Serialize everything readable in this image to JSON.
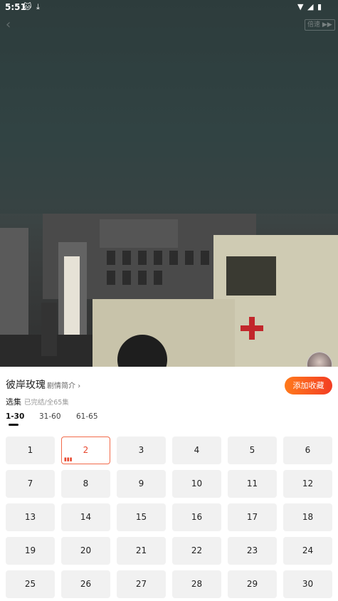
{
  "status_bar": {
    "time": "5:51"
  },
  "player": {
    "speed_label": "倍速"
  },
  "drama": {
    "title": "彼岸玫瑰",
    "synopsis_label": "剧情简介",
    "favorite_label": "添加收藏"
  },
  "episodes": {
    "section_label": "选集",
    "status_text": "已完结/全65集",
    "ranges": [
      "1-30",
      "31-60",
      "61-65"
    ],
    "active_range": 0,
    "active_episode": 2,
    "list": [
      "1",
      "2",
      "3",
      "4",
      "5",
      "6",
      "7",
      "8",
      "9",
      "10",
      "11",
      "12",
      "13",
      "14",
      "15",
      "16",
      "17",
      "18",
      "19",
      "20",
      "21",
      "22",
      "23",
      "24",
      "25",
      "26",
      "27",
      "28",
      "29",
      "30"
    ]
  },
  "colors": {
    "accent": "#e8452c",
    "favorite_gradient_start": "#ff7a1c",
    "favorite_gradient_end": "#f33d23"
  },
  "icons": [
    "cat-icon",
    "download-icon",
    "wifi-icon",
    "signal-icon",
    "battery-icon",
    "back-icon",
    "chevron-right-icon",
    "playing-icon"
  ]
}
